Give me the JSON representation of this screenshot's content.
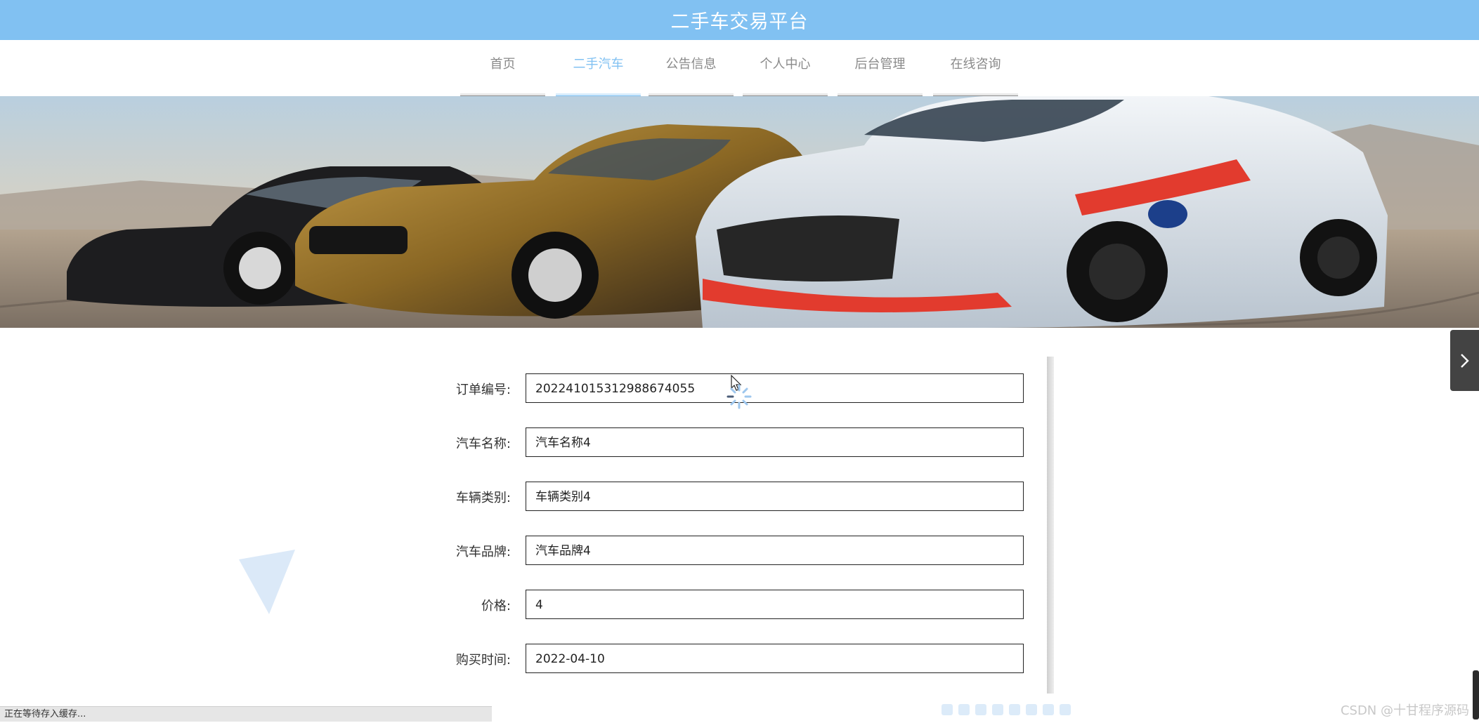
{
  "header": {
    "title": "二手车交易平台"
  },
  "nav": {
    "items": [
      {
        "label": "首页",
        "active": false
      },
      {
        "label": "二手汽车",
        "active": true
      },
      {
        "label": "公告信息",
        "active": false
      },
      {
        "label": "个人中心",
        "active": false
      },
      {
        "label": "后台管理",
        "active": false
      },
      {
        "label": "在线咨询",
        "active": false
      }
    ]
  },
  "banner": {
    "image": "sports-cars-banner"
  },
  "form": {
    "fields": [
      {
        "label": "订单编号:",
        "value": "202241015312988674055"
      },
      {
        "label": "汽车名称:",
        "value": "汽车名称4"
      },
      {
        "label": "车辆类别:",
        "value": "车辆类别4"
      },
      {
        "label": "汽车品牌:",
        "value": "汽车品牌4"
      },
      {
        "label": "价格:",
        "value": "4"
      },
      {
        "label": "购买时间:",
        "value": "2022-04-10"
      }
    ]
  },
  "side_button": {
    "icon": "chevron-right-icon"
  },
  "status_bar": {
    "text": "正在等待存入缓存..."
  },
  "watermark": {
    "text": "CSDN @十甘程序源码"
  },
  "colors": {
    "accent": "#81c1f2",
    "nav_bar": "#8e8e8e",
    "side_button": "#434343"
  }
}
